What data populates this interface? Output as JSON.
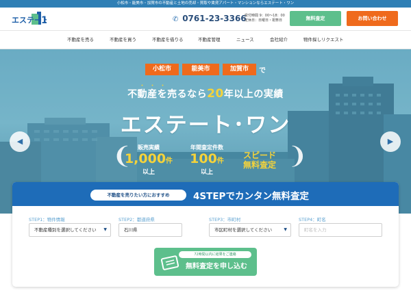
{
  "topbar": {
    "text": "小松市・能美市・加賀市の不動産と土地の売却・買取や賃貸アパート・マンションならエステート・ワン"
  },
  "header": {
    "logo_text": "エステート",
    "logo_number": "1",
    "phone_icon": "phone-icon",
    "phone": "0761-23-3366",
    "hours_line1": "受付時間 9：00〜18：00",
    "hours_line2": "定休日：日曜日・祝祭日",
    "assess_label": "無料査定",
    "contact_label": "お問い合わせ"
  },
  "nav": {
    "items": [
      {
        "label": "不動産を売る"
      },
      {
        "label": "不動産を買う"
      },
      {
        "label": "不動産を借りる"
      },
      {
        "label": "不動産管理"
      },
      {
        "label": "ニュース"
      },
      {
        "label": "会社紹介"
      },
      {
        "label": "物件探しリクエスト"
      }
    ]
  },
  "hero": {
    "areas": [
      "小松市",
      "能美市",
      "加賀市"
    ],
    "area_suffix": "で",
    "dots": "・・・",
    "catch_pre": "不動産を売るなら",
    "catch_years": "20",
    "catch_post": "年以上の実績",
    "brand": "エステート･ワン",
    "stats": [
      {
        "label": "販売実績",
        "value": "1,000",
        "unit": "件",
        "sub": "以上"
      },
      {
        "label": "年間査定件数",
        "value": "100",
        "unit": "件",
        "sub": "以上"
      },
      {
        "label": "",
        "value": "",
        "unit": "",
        "sub": ""
      }
    ],
    "speed_line1": "スピード",
    "speed_line2": "無料査定",
    "prev_icon": "◀",
    "next_icon": "▶"
  },
  "steps": {
    "pill": "不動産を売りたい方におすすめ",
    "title": "4STEPでカンタン無料査定",
    "fields": [
      {
        "label": "STEP1：物件情報",
        "value": "不動産種別を選択してください",
        "type": "select"
      },
      {
        "label": "STEP2：都道府県",
        "value": "石川県",
        "type": "text"
      },
      {
        "label": "STEP3：市町村",
        "value": "市区町村を選択してください",
        "type": "select"
      },
      {
        "label": "STEP4：町名",
        "placeholder": "町名を入力",
        "type": "input"
      }
    ],
    "submit_note": "72時間以内に結果をご連絡",
    "submit_label": "無料査定を申し込む"
  },
  "colors": {
    "topbar": "#2f7fb5",
    "accent_green": "#5dbf8c",
    "accent_orange": "#ef6a1c",
    "step_blue": "#1e6cb8",
    "highlight_yellow": "#f5d33a"
  }
}
